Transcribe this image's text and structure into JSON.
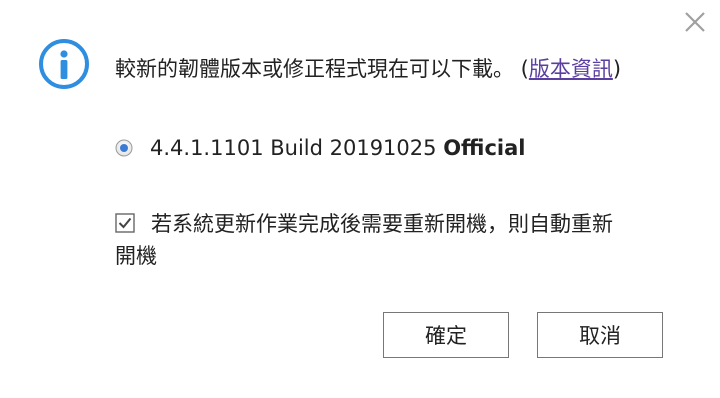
{
  "dialog": {
    "message": "較新的韌體版本或修正程式現在可以下載。",
    "paren_open": " (",
    "release_notes_link": "版本資訊",
    "paren_close": ")",
    "version_option": {
      "version": "4.4.1.1101 Build 20191025",
      "tag": "Official",
      "selected": true
    },
    "auto_restart": {
      "label_line1": "若系統更新作業完成後需要重新開機，則自動重新",
      "label_line2": "開機",
      "checked": true
    },
    "buttons": {
      "ok_label": "確定",
      "cancel_label": "取消"
    }
  },
  "icons": {
    "info": "info-icon",
    "close": "close-icon",
    "radio": "radio-selected-icon",
    "checkbox": "checkbox-checked-icon"
  },
  "colors": {
    "info_blue": "#2f8ee0",
    "link_purple": "#5a3fa0",
    "close_gray": "#a0a0a0"
  }
}
